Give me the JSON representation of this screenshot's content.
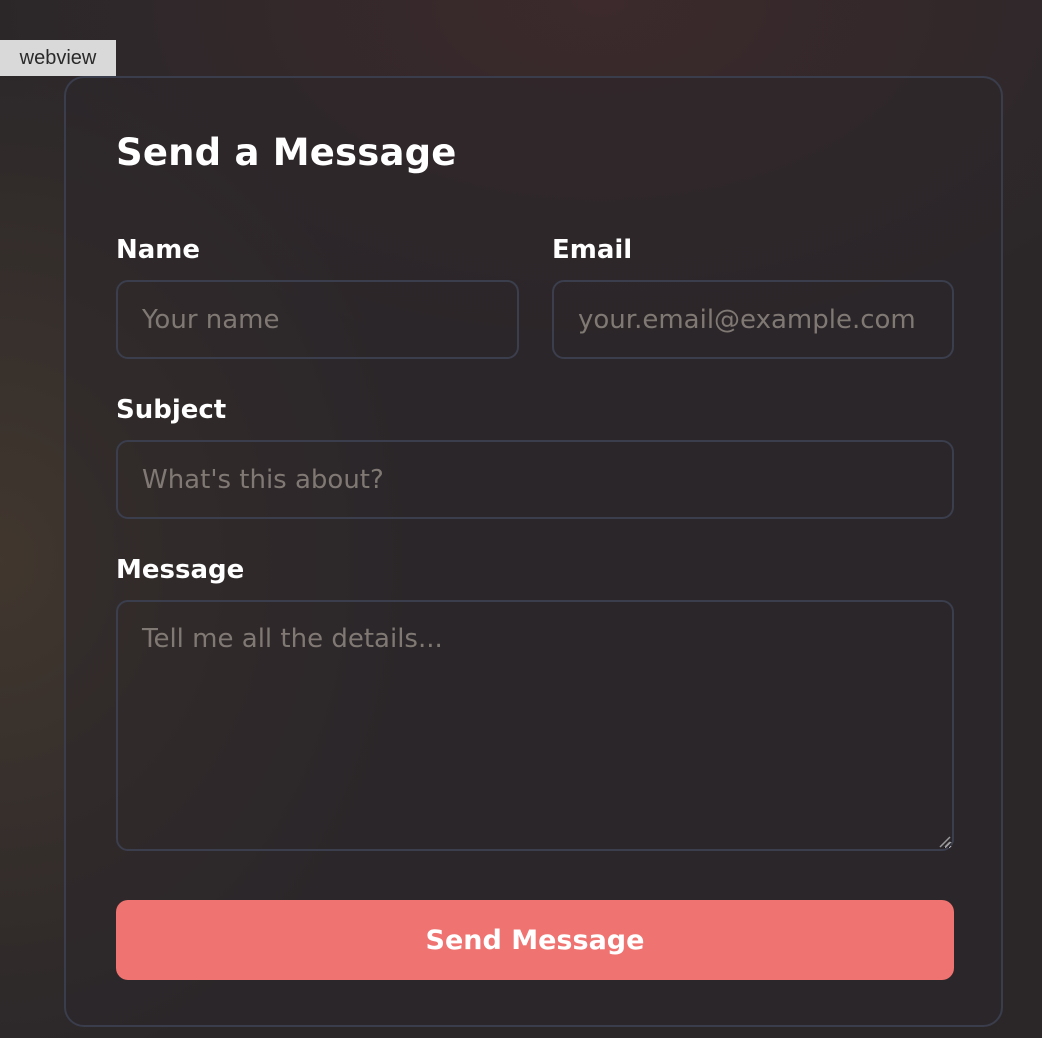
{
  "webview_tag": "webview",
  "form": {
    "title": "Send a Message",
    "name": {
      "label": "Name",
      "placeholder": "Your name",
      "value": ""
    },
    "email": {
      "label": "Email",
      "placeholder": "your.email@example.com",
      "value": ""
    },
    "subject": {
      "label": "Subject",
      "placeholder": "What's this about?",
      "value": ""
    },
    "message": {
      "label": "Message",
      "placeholder": "Tell me all the details...",
      "value": ""
    },
    "submit_label": "Send Message"
  },
  "colors": {
    "accent": "#ef7370",
    "field_border": "#3b3e4d",
    "placeholder": "#7f7873",
    "background": "#2b2729"
  },
  "icons": {
    "textarea_resize": "resize-grip-icon"
  }
}
